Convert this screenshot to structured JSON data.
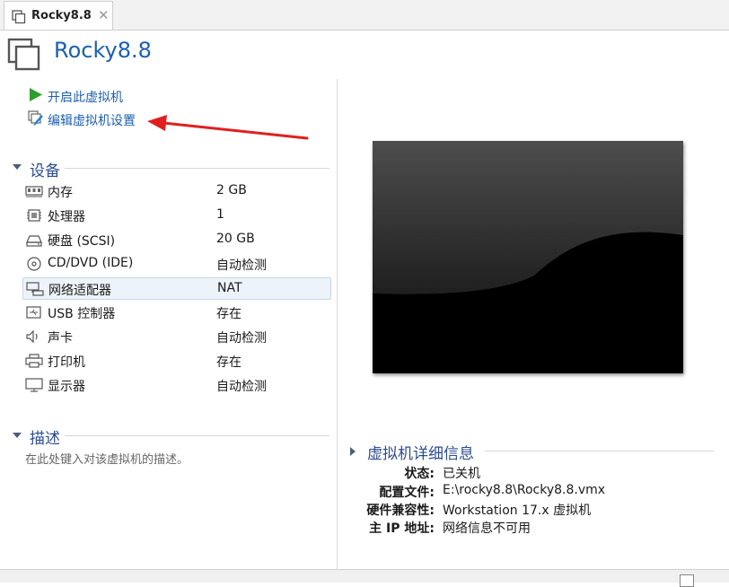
{
  "tab": {
    "title": "Rocky8.8",
    "close": "✕"
  },
  "vm": {
    "name": "Rocky8.8"
  },
  "actions": {
    "power_on": "开启此虚拟机",
    "edit_settings": "编辑虚拟机设置"
  },
  "devices": {
    "header": "设备",
    "items": [
      {
        "name": "内存",
        "value": "2 GB",
        "icon": "memory-icon"
      },
      {
        "name": "处理器",
        "value": "1",
        "icon": "processor-icon"
      },
      {
        "name": "硬盘 (SCSI)",
        "value": "20 GB",
        "icon": "hard-disk-icon"
      },
      {
        "name": "CD/DVD (IDE)",
        "value": "自动检测",
        "icon": "cd-dvd-icon"
      },
      {
        "name": "网络适配器",
        "value": "NAT",
        "icon": "network-adapter-icon"
      },
      {
        "name": "USB 控制器",
        "value": "存在",
        "icon": "usb-icon"
      },
      {
        "name": "声卡",
        "value": "自动检测",
        "icon": "speaker-icon"
      },
      {
        "name": "打印机",
        "value": "存在",
        "icon": "printer-icon"
      },
      {
        "name": "显示器",
        "value": "自动检测",
        "icon": "monitor-icon"
      }
    ]
  },
  "description": {
    "header": "描述",
    "placeholder": "在此处键入对该虚拟机的描述。"
  },
  "details": {
    "header": "虚拟机详细信息",
    "state_label": "状态:",
    "state_value": "已关机",
    "config_label": "配置文件:",
    "config_value": "E:\\rocky8.8\\Rocky8.8.vmx",
    "compat_label": "硬件兼容性:",
    "compat_value": "Workstation 17.x 虚拟机",
    "ip_label": "主 IP 地址:",
    "ip_value": "网络信息不可用"
  },
  "colors": {
    "title": "#1c5fb0",
    "link": "#1d5fad",
    "section_header": "#2c4d8f",
    "annotation_arrow": "#e02020",
    "play_green": "#2e9e2e"
  }
}
